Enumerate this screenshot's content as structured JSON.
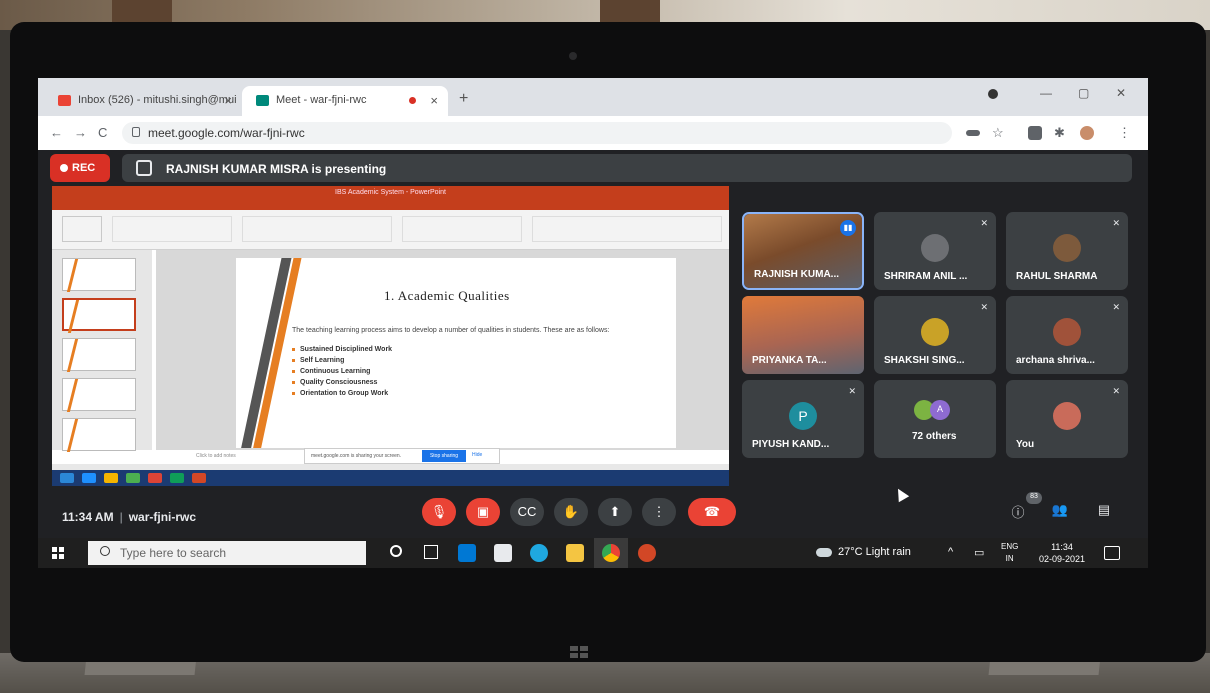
{
  "browser": {
    "tabs": [
      {
        "label": "Inbox (526) - mitushi.singh@mui",
        "close": "×"
      },
      {
        "label": "Meet - war-fjni-rwc",
        "close": "×"
      }
    ],
    "new_tab": "+",
    "window_controls": [
      "—",
      "▢",
      "✕"
    ],
    "nav": {
      "back": "←",
      "forward": "→",
      "reload": "C"
    },
    "url": "meet.google.com/war-fjni-rwc"
  },
  "meet": {
    "rec_label": "REC",
    "presenting_text": "RAJNISH KUMAR MISRA is presenting",
    "meeting_time": "11:34 AM",
    "meeting_separator": "|",
    "meeting_code": "war-fjni-rwc",
    "participant_count_badge": "83",
    "participants": [
      {
        "name": "RAJNISH KUMA..."
      },
      {
        "name": "SHRIRAM ANIL ..."
      },
      {
        "name": "RAHUL SHARMA"
      },
      {
        "name": "PRIYANKA TA..."
      },
      {
        "name": "SHAKSHI SING..."
      },
      {
        "name": "archana shriva..."
      },
      {
        "name": "PIYUSH KAND...",
        "initial": "P"
      },
      {
        "name": "72 others",
        "initial": "A"
      },
      {
        "name": "You"
      }
    ]
  },
  "presentation": {
    "app_title": "IBS Academic System - PowerPoint",
    "slide_title": "1. Academic Qualities",
    "intro": "The teaching learning process aims to develop a number of qualities in students. These are as follows:",
    "bullets": [
      "Sustained Disciplined Work",
      "Self Learning",
      "Continuous Learning",
      "Quality Consciousness",
      "Orientation to Group Work"
    ],
    "notes_placeholder": "Click to add notes",
    "share_notice": "meet.google.com is sharing your screen.",
    "stop_sharing": "Stop sharing",
    "hide": "Hide"
  },
  "taskbar": {
    "search_placeholder": "Type here to search",
    "weather": "27°C  Light rain",
    "lang_top": "ENG",
    "lang_bottom": "IN",
    "time": "11:34",
    "date": "02-09-2021"
  },
  "colors": {
    "meet_bg": "#202124",
    "tile_bg": "#3c4043",
    "rec_red": "#d93025",
    "powerpoint_orange": "#c43e1c",
    "accent_blue": "#1a73e8"
  }
}
